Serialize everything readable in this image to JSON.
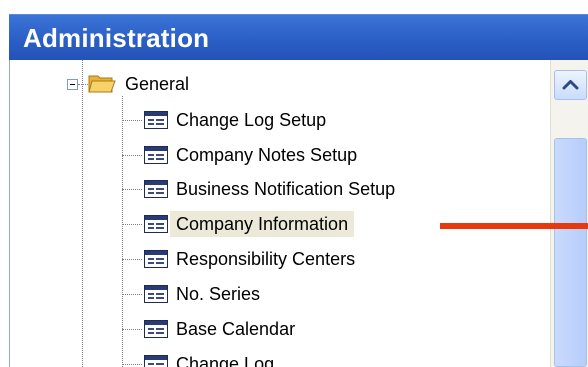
{
  "header": {
    "title": "Administration"
  },
  "tree": {
    "root": {
      "label": "General",
      "expanded": true
    },
    "items": [
      {
        "label": "Change Log Setup"
      },
      {
        "label": "Company Notes Setup"
      },
      {
        "label": "Business Notification Setup"
      },
      {
        "label": "Company Information",
        "selected": true
      },
      {
        "label": "Responsibility Centers"
      },
      {
        "label": "No. Series"
      },
      {
        "label": "Base Calendar"
      },
      {
        "label": "Change Log"
      }
    ]
  },
  "icons": {
    "expander": "minus-expander-icon",
    "folder": "open-folder-icon",
    "item": "form-window-icon",
    "scroll_up": "chevron-up-icon"
  },
  "colors": {
    "header_bg": "#2b5fc6",
    "header_text": "#ffffff",
    "selection_bg": "#ece9d8",
    "annotation_arrow": "#e8380e"
  }
}
